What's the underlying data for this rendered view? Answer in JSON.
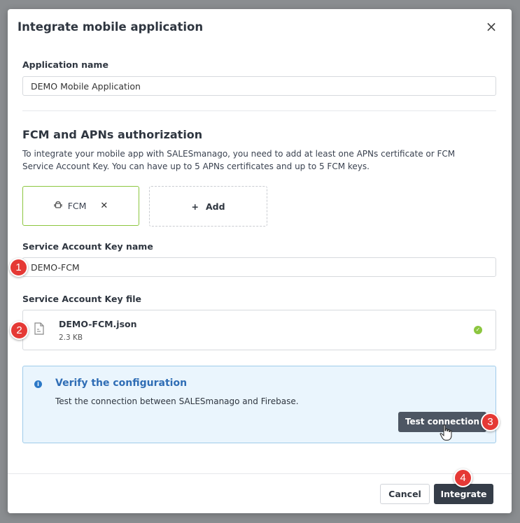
{
  "dialog": {
    "title": "Integrate mobile application",
    "close_glyph": "×"
  },
  "app_name": {
    "label": "Application name",
    "value": "DEMO Mobile Application"
  },
  "auth": {
    "title": "FCM and APNs authorization",
    "description": "To integrate your mobile app with SALESmanago, you need to add at least one APNs certificate or FCM Service Account Key. You can have up to 5 APNs certificates and up to 5 FCM keys.",
    "fcm_card_label": "FCM",
    "fcm_icon": "android-icon",
    "remove_glyph": "✕",
    "add_glyph": "+",
    "add_label": "Add"
  },
  "key_name": {
    "label": "Service Account Key name",
    "value": "DEMO-FCM"
  },
  "key_file": {
    "label": "Service Account Key file",
    "file_name": "DEMO-FCM.json",
    "file_size": "2.3 KB",
    "file_icon": "file-icon",
    "status_icon": "check-circle-icon",
    "check_glyph": "✓"
  },
  "verify": {
    "info_glyph": "i",
    "title": "Verify the configuration",
    "text": "Test the connection between SALESmanago and Firebase.",
    "button_label": "Test connection"
  },
  "footer": {
    "cancel_label": "Cancel",
    "integrate_label": "Integrate"
  },
  "steps": [
    "1",
    "2",
    "3",
    "4"
  ],
  "colors": {
    "accent_green": "#8cc63f",
    "info_blue": "#2f6db5",
    "info_bg": "#eaf5fd",
    "dark_button": "#353d48",
    "step_badge": "#e53935"
  }
}
